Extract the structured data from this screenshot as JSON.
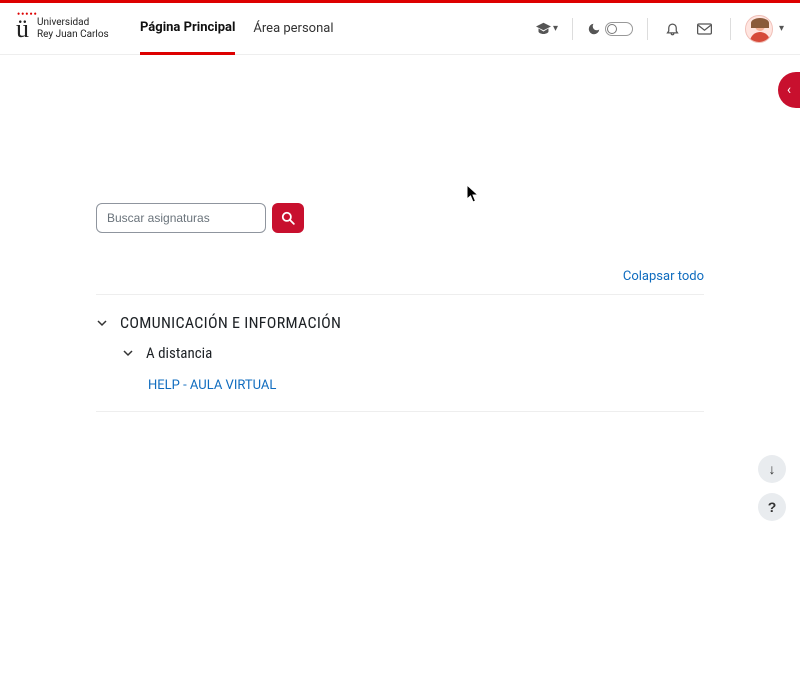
{
  "brand": {
    "name_line1": "Universidad",
    "name_line2": "Rey Juan Carlos"
  },
  "nav": {
    "home": "Página Principal",
    "dashboard": "Área personal"
  },
  "search": {
    "placeholder": "Buscar asignaturas"
  },
  "actions": {
    "collapse_all": "Colapsar todo"
  },
  "tree": {
    "cat1": {
      "label": "COMUNICACIÓN E INFORMACIÓN",
      "sub1": {
        "label": "A distancia",
        "items": {
          "0": {
            "label": "HELP - AULA VIRTUAL"
          }
        }
      }
    }
  },
  "float": {
    "scroll_down": "↓",
    "help": "?"
  }
}
